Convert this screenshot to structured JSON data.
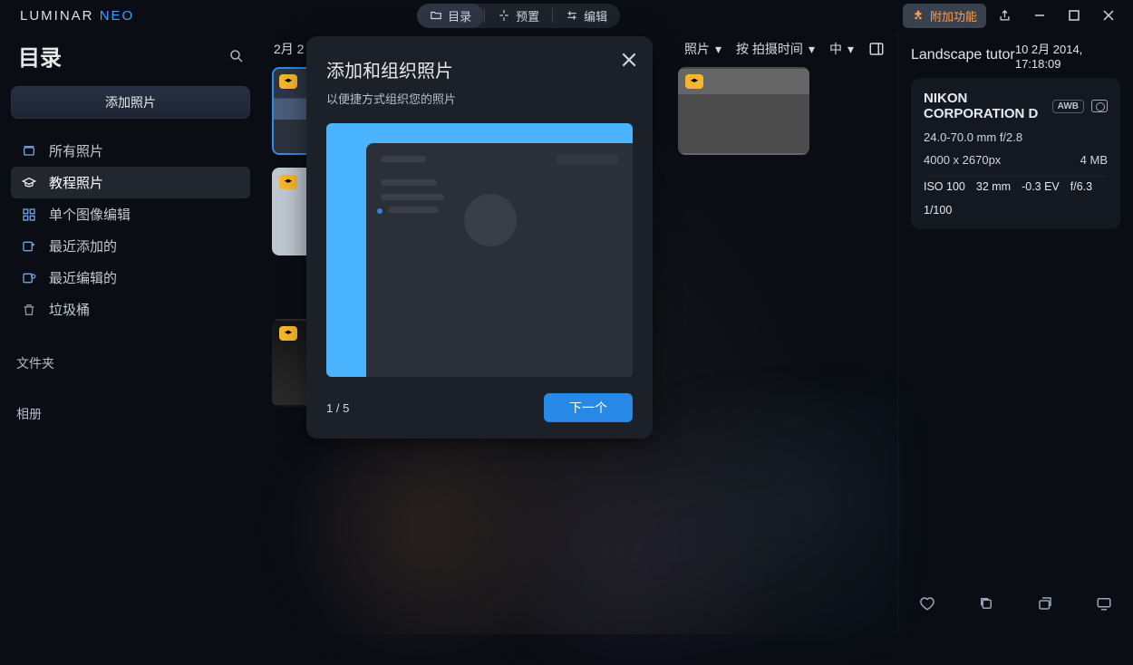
{
  "brand": {
    "name": "LUMINAR ",
    "suffix": "NEO"
  },
  "top_tabs": {
    "catalog": "目录",
    "presets": "预置",
    "edit": "编辑"
  },
  "addon_label": "附加功能",
  "sidebar": {
    "title": "目录",
    "add_button": "添加照片",
    "items": [
      {
        "icon": "images-icon",
        "label": "所有照片"
      },
      {
        "icon": "grad-cap-icon",
        "label": "教程照片"
      },
      {
        "icon": "grid-icon",
        "label": "单个图像编辑"
      },
      {
        "icon": "recent-add-icon",
        "label": "最近添加的"
      },
      {
        "icon": "recent-edit-icon",
        "label": "最近编辑的"
      },
      {
        "icon": "trash-icon",
        "label": "垃圾桶"
      }
    ],
    "section_folders": "文件夹",
    "section_albums": "相册"
  },
  "toolbar2": {
    "date": "2月 2",
    "photos_suffix": " 照片",
    "sort": "按 拍摄时间",
    "size": "中",
    "photos_dropdown_icon": "▾"
  },
  "onboarding": {
    "title": "添加和组织照片",
    "subtitle": "以便捷方式组织您的照片",
    "step": "1 / 5",
    "next": "下一个"
  },
  "info": {
    "filename": "Landscape tutoria",
    "timestamp": "10 2月 2014, 17:18:09",
    "camera": "NIKON CORPORATION D",
    "awb": "AWB",
    "lens": "24.0-70.0 mm f/2.8",
    "dimensions": "4000 x 2670px",
    "filesize": "4 MB",
    "iso": "ISO 100",
    "focal": "32 mm",
    "ev": "-0.3 EV",
    "aperture": "f/6.3",
    "shutter": "1/100"
  }
}
